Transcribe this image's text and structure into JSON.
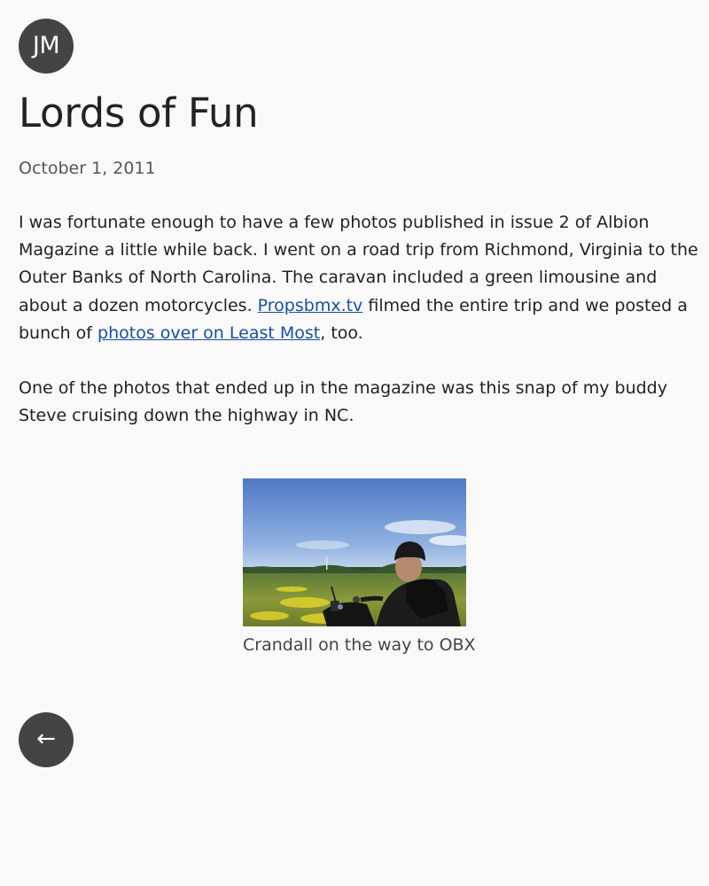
{
  "header": {
    "avatar_initials": "JM"
  },
  "post": {
    "title": "Lords of Fun",
    "date": "October 1, 2011",
    "p1": {
      "text_before_link1": "I was fortunate enough to have a few photos published in issue 2 of Albion Magazine a little while back. I went on a road trip from Richmond, Virginia to the Outer Banks of North Carolina. The caravan included a green limousine and about a dozen motorcycles. ",
      "link1": "Propsbmx.tv",
      "text_between_links": " filmed the entire trip and we posted a bunch of ",
      "link2": "photos over on Least Most",
      "text_after_link2": ", too."
    },
    "p2": "One of the photos that ended up in the magazine was this snap of my buddy Steve cruising down the highway in NC.",
    "figure": {
      "caption": "Crandall on the way to OBX"
    }
  },
  "nav": {
    "back_arrow": "←"
  },
  "colors": {
    "background": "#f9f9f9",
    "text": "#222222",
    "link": "#1a4fa0",
    "circle_button": "#444444"
  }
}
